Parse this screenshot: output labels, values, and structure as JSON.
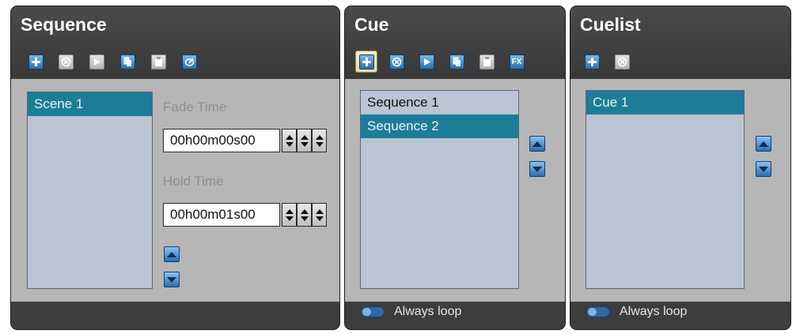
{
  "sequence": {
    "title": "Sequence",
    "toolbar": [
      {
        "icon": "add-icon",
        "enabled": true
      },
      {
        "icon": "remove-icon",
        "enabled": false
      },
      {
        "icon": "play-icon",
        "enabled": false
      },
      {
        "icon": "copy-icon",
        "enabled": true
      },
      {
        "icon": "paste-icon",
        "enabled": false
      },
      {
        "icon": "edit-icon",
        "enabled": true
      }
    ],
    "scenes": [
      "Scene 1"
    ],
    "selected_scene": "Scene 1",
    "fade_time_label": "Fade Time",
    "fade_time_value": "00h00m00s00",
    "hold_time_label": "Hold Time",
    "hold_time_value": "00h00m01s00"
  },
  "cue": {
    "title": "Cue",
    "toolbar": [
      {
        "icon": "add-icon",
        "enabled": true,
        "selected": true
      },
      {
        "icon": "remove-icon",
        "enabled": true
      },
      {
        "icon": "play-icon",
        "enabled": true
      },
      {
        "icon": "copy-icon",
        "enabled": true
      },
      {
        "icon": "paste-icon",
        "enabled": false
      },
      {
        "icon": "fx-icon",
        "enabled": true,
        "text": "FX"
      }
    ],
    "items": [
      "Sequence 1",
      "Sequence 2"
    ],
    "selected_item": "Sequence 2",
    "loop_label": "Always loop"
  },
  "cuelist": {
    "title": "Cuelist",
    "toolbar": [
      {
        "icon": "add-icon",
        "enabled": true
      },
      {
        "icon": "remove-icon",
        "enabled": false
      }
    ],
    "items": [
      "Cue 1"
    ],
    "selected_item": "Cue 1",
    "loop_label": "Always loop"
  },
  "colors": {
    "panel_bg": "#3d3d3d",
    "body_bg": "#b6b6b6",
    "list_bg": "#bac4d2",
    "selection": "#1d7c98",
    "icon_blue": "#2a6fb2"
  }
}
